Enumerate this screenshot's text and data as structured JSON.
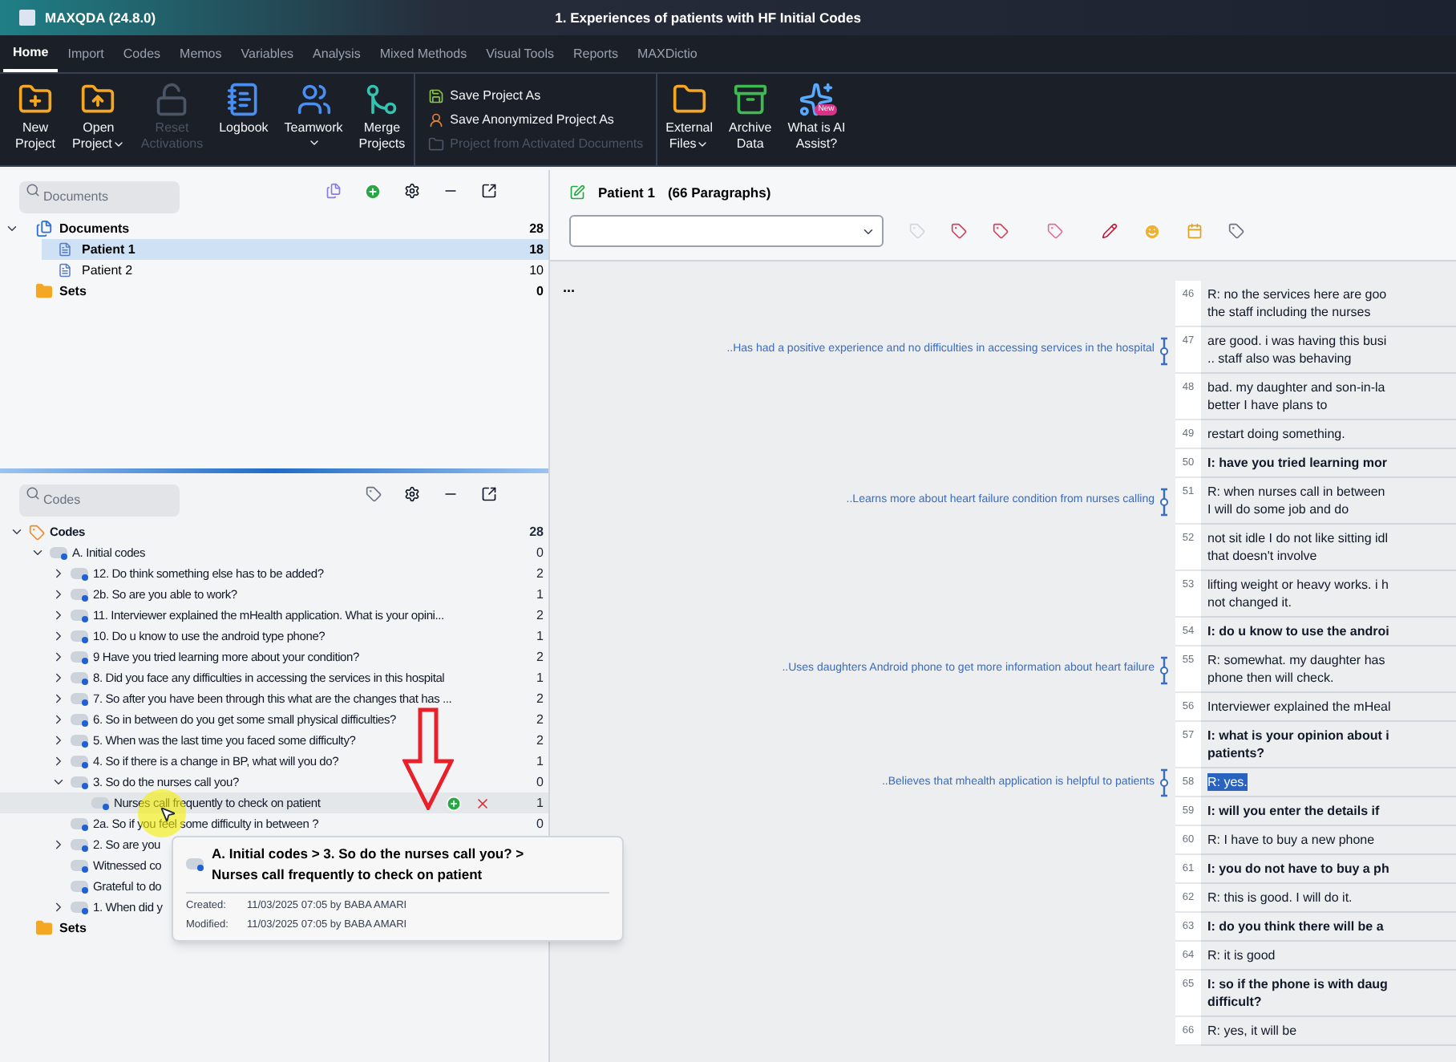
{
  "window": {
    "app_title": "MAXQDA (24.8.0)",
    "project_title": "1. Experiences of patients with HF Initial Codes"
  },
  "menu_tabs": [
    {
      "label": "Home",
      "selected": true
    },
    {
      "label": "Import",
      "selected": false
    },
    {
      "label": "Codes",
      "selected": false
    },
    {
      "label": "Memos",
      "selected": false
    },
    {
      "label": "Variables",
      "selected": false
    },
    {
      "label": "Analysis",
      "selected": false
    },
    {
      "label": "Mixed Methods",
      "selected": false
    },
    {
      "label": "Visual Tools",
      "selected": false
    },
    {
      "label": "Reports",
      "selected": false
    },
    {
      "label": "MAXDictio",
      "selected": false
    }
  ],
  "ribbon": [
    {
      "kind": "large",
      "lines": [
        "New",
        "Project"
      ],
      "dropdown": false,
      "disabled": false
    },
    {
      "kind": "large",
      "lines": [
        "Open",
        "Project"
      ],
      "dropdown": true,
      "disabled": false
    },
    {
      "kind": "large",
      "lines": [
        "Reset",
        "Activations"
      ],
      "dropdown": false,
      "disabled": true
    },
    {
      "kind": "large",
      "lines": [
        "Logbook"
      ],
      "dropdown": false,
      "disabled": false
    },
    {
      "kind": "large",
      "lines": [
        "Teamwork"
      ],
      "dropdown": true,
      "disabled": false
    },
    {
      "kind": "large",
      "lines": [
        "Merge",
        "Projects"
      ],
      "dropdown": false,
      "disabled": false
    },
    {
      "kind": "stack",
      "items": [
        {
          "label": "Save Project As",
          "disabled": false
        },
        {
          "label": "Save Anonymized Project As",
          "disabled": false
        },
        {
          "label": "Project from Activated Documents",
          "disabled": true
        }
      ]
    },
    {
      "kind": "large",
      "lines": [
        "External",
        "Files"
      ],
      "dropdown": true,
      "disabled": false
    },
    {
      "kind": "large",
      "lines": [
        "Archive",
        "Data"
      ],
      "dropdown": false,
      "disabled": false
    },
    {
      "kind": "large",
      "lines": [
        "What is AI",
        "Assist?"
      ],
      "dropdown": false,
      "disabled": false,
      "badge": "New"
    }
  ],
  "documents_panel": {
    "search_placeholder": "Documents",
    "root": {
      "label": "Documents",
      "count": "28",
      "expanded": true,
      "children": [
        {
          "label": "Patient 1",
          "count": "18",
          "selected": true
        },
        {
          "label": "Patient 2",
          "count": "10",
          "selected": false
        }
      ]
    },
    "sets": {
      "label": "Sets",
      "count": "0"
    }
  },
  "codes_panel": {
    "search_placeholder": "Codes",
    "root": {
      "label": "Codes",
      "count": "28",
      "expanded": true,
      "children": [
        {
          "label": "A. Initial codes",
          "count": "0",
          "expanded": true,
          "children": [
            {
              "label": "12. Do think something else has to be added?",
              "count": "2",
              "expanded": false
            },
            {
              "label": "2b. So are you able to work?",
              "count": "1",
              "expanded": false
            },
            {
              "label": "11. Interviewer explained the mHealth application.  What is your opini...",
              "count": "2",
              "expanded": false
            },
            {
              "label": "10. Do u know to use the android type phone?",
              "count": "1",
              "expanded": false
            },
            {
              "label": "9 Have you tried learning more about your condition?",
              "count": "2",
              "expanded": false
            },
            {
              "label": "8. Did you face any difficulties in accessing the services in this hospital",
              "count": "1",
              "expanded": false
            },
            {
              "label": "7. So after you have been through this what are the changes that has ...",
              "count": "2",
              "expanded": false
            },
            {
              "label": "6. So in between do you get some small physical difficulties?",
              "count": "2",
              "expanded": false
            },
            {
              "label": "5.  When was the last time you faced some difficulty?",
              "count": "2",
              "expanded": false
            },
            {
              "label": "4. So if there is a change in BP, what will you do?",
              "count": "1",
              "expanded": false
            },
            {
              "label": "3. So do the nurses call you?",
              "count": "0",
              "expanded": true,
              "children": [
                {
                  "label": "Nurses call frequently to check on patient",
                  "count": "1",
                  "hovered": true
                }
              ]
            },
            {
              "label": "2a. So if you feel some difficulty in between ?",
              "count": "0"
            },
            {
              "label": "2. So are you",
              "expanded": false
            },
            {
              "label": "Witnessed co"
            },
            {
              "label": "Grateful to do"
            },
            {
              "label": "1. When did y",
              "expanded": false
            }
          ]
        }
      ]
    },
    "sets": {
      "label": "Sets"
    }
  },
  "tooltip": {
    "path": "A. Initial codes > 3. So do the nurses call you? >",
    "code": "Nurses call frequently to check on patient",
    "created_label": "Created:",
    "created": "11/03/2025 07:05 by BABA AMARI",
    "modified_label": "Modified:",
    "modified": "11/03/2025 07:05 by BABA AMARI"
  },
  "document": {
    "title": "Patient 1",
    "paragraph_count": "(66 Paragraphs)",
    "ellipsis": "...",
    "paragraphs": [
      {
        "number": "46",
        "lines": [
          "R: no the services here are goo",
          "the staff including the nurses"
        ],
        "bold": false,
        "selected": false
      },
      {
        "number": "47",
        "lines": [
          "are good. i was having this busi",
          ".. staff also was behaving"
        ],
        "bold": false,
        "selected": false,
        "code_label": "..Has had a positive experience and no difficulties in accessing services in the hospital"
      },
      {
        "number": "48",
        "lines": [
          "bad. my daughter and son-in-la",
          "better I have plans to"
        ],
        "bold": false,
        "selected": false
      },
      {
        "number": "49",
        "lines": [
          "restart doing something."
        ],
        "bold": false,
        "selected": false
      },
      {
        "number": "50",
        "lines": [
          "I: have you tried learning mor"
        ],
        "bold": true,
        "selected": false
      },
      {
        "number": "51",
        "lines": [
          "R: when nurses call in between",
          "I will do some job and do"
        ],
        "bold": false,
        "selected": false,
        "code_label": "..Learns more about heart failure condition from nurses calling"
      },
      {
        "number": "52",
        "lines": [
          "not sit idle I do not like sitting idl",
          "that doesn't involve"
        ],
        "bold": false,
        "selected": false
      },
      {
        "number": "53",
        "lines": [
          "lifting weight or heavy works. i h",
          "not changed it."
        ],
        "bold": false,
        "selected": false
      },
      {
        "number": "54",
        "lines": [
          "I: do u know to use the androi"
        ],
        "bold": true,
        "selected": false
      },
      {
        "number": "55",
        "lines": [
          "R: somewhat. my daughter has",
          "phone then will check."
        ],
        "bold": false,
        "selected": false,
        "code_label": "..Uses daughters Android phone to get more information about heart failure"
      },
      {
        "number": "56",
        "lines": [
          "Interviewer explained the mHeal"
        ],
        "bold": false,
        "selected": false
      },
      {
        "number": "57",
        "lines": [
          "I: what is your opinion about i",
          "patients?"
        ],
        "bold": true,
        "selected": false
      },
      {
        "number": "58",
        "lines": [
          "R: yes."
        ],
        "bold": false,
        "selected": true,
        "code_label": "..Believes that mhealth application is helpful to patients"
      },
      {
        "number": "59",
        "lines": [
          "I: will you enter the details if"
        ],
        "bold": true,
        "selected": false
      },
      {
        "number": "60",
        "lines": [
          "R: I have to buy a new phone"
        ],
        "bold": false,
        "selected": false
      },
      {
        "number": "61",
        "lines": [
          "I: you do not have to buy a ph"
        ],
        "bold": true,
        "selected": false
      },
      {
        "number": "62",
        "lines": [
          "R: this is good. I will do it."
        ],
        "bold": false,
        "selected": false
      },
      {
        "number": "63",
        "lines": [
          "I: do you think there will be a"
        ],
        "bold": true,
        "selected": false
      },
      {
        "number": "64",
        "lines": [
          "R: it is good"
        ],
        "bold": false,
        "selected": false
      },
      {
        "number": "65",
        "lines": [
          "I: so if the phone is with daug",
          "difficult?"
        ],
        "bold": true,
        "selected": false
      },
      {
        "number": "66",
        "lines": [
          "R: yes, it will be"
        ],
        "bold": false,
        "selected": false
      }
    ]
  }
}
